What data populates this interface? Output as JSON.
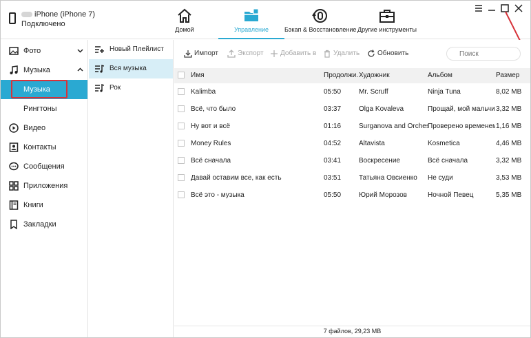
{
  "device": {
    "name": "iPhone (iPhone 7)",
    "status": "Подключено"
  },
  "nav": {
    "tabs": [
      {
        "label": "Домой",
        "icon": "home-icon"
      },
      {
        "label": "Управление",
        "icon": "folder-icon"
      },
      {
        "label": "Бэкап & Восстановление",
        "icon": "backup-restore-icon"
      },
      {
        "label": "Другие инструменты",
        "icon": "toolbox-icon"
      }
    ],
    "active_tab": "Управление"
  },
  "sidebar": {
    "items": [
      {
        "label": "Фото",
        "icon": "photo-icon"
      },
      {
        "label": "Музыка",
        "icon": "music-note-icon"
      },
      {
        "label": "Музыка",
        "icon": ""
      },
      {
        "label": "Рингтоны",
        "icon": ""
      },
      {
        "label": "Видео",
        "icon": "play-circle-icon"
      },
      {
        "label": "Контакты",
        "icon": "contacts-icon"
      },
      {
        "label": "Сообщения",
        "icon": "messages-icon"
      },
      {
        "label": "Приложения",
        "icon": "apps-grid-icon"
      },
      {
        "label": "Книги",
        "icon": "book-icon"
      },
      {
        "label": "Закладки",
        "icon": "bookmark-icon"
      }
    ],
    "selected": "Музыка"
  },
  "playlists": {
    "items": [
      {
        "label": "Новый Плейлист",
        "icon": "add-playlist-icon"
      },
      {
        "label": "Вся музыка",
        "icon": "playlist-icon"
      },
      {
        "label": "Рок",
        "icon": "playlist-icon"
      }
    ],
    "selected": "Вся музыка"
  },
  "toolbar": {
    "import_label": "Импорт",
    "export_label": "Экспорт",
    "add_label": "Добавить в",
    "delete_label": "Удалить",
    "refresh_label": "Обновить",
    "search_placeholder": "Поиск"
  },
  "table": {
    "columns": [
      "Имя",
      "Продолжи...",
      "Художник",
      "Альбом",
      "Размер"
    ],
    "rows": [
      {
        "name": "Kalimba",
        "duration": "05:50",
        "artist": "Mr. Scruff",
        "album": "Ninja Tuna",
        "size": "8,02 MB"
      },
      {
        "name": "Всё, что было",
        "duration": "03:37",
        "artist": "Olga Kovaleva",
        "album": "Прощай, мой мальчи...",
        "size": "3,32 MB"
      },
      {
        "name": "Ну вот и всё",
        "duration": "01:16",
        "artist": "Surganova and Orches...",
        "album": "Проверено временем...",
        "size": "1,16 MB"
      },
      {
        "name": "Money Rules",
        "duration": "04:52",
        "artist": "Altavista",
        "album": "Kosmetica",
        "size": "4,46 MB"
      },
      {
        "name": "Всё сначала",
        "duration": "03:41",
        "artist": "Воскресение",
        "album": "Всё сначала",
        "size": "3,32 MB"
      },
      {
        "name": "Давай оставим все, как есть",
        "duration": "03:51",
        "artist": "Татьяна Овсиенко",
        "album": "Не суди",
        "size": "3,53 MB"
      },
      {
        "name": "Всё это - музыка",
        "duration": "05:50",
        "artist": "Юрий Морозов",
        "album": "Ночной Певец",
        "size": "5,35 MB"
      }
    ]
  },
  "footer": {
    "summary": "7 файлов, 29,23 MB"
  },
  "colors": {
    "accent": "#2aa9d2",
    "selected_playlist_bg": "#d7eef7",
    "highlight_border": "#d6333a"
  }
}
